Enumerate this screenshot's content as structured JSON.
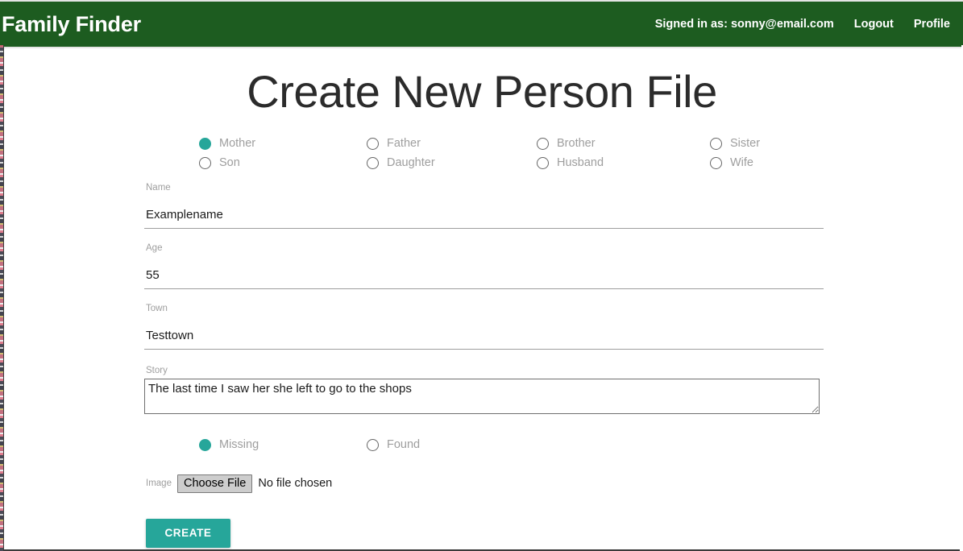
{
  "navbar": {
    "brand": "Family Finder",
    "signed_in_text": "Signed in as: sonny@email.com",
    "logout_label": "Logout",
    "profile_label": "Profile"
  },
  "page": {
    "title": "Create New Person File"
  },
  "colors": {
    "navbar_green": "#1d5c20",
    "accent_teal": "#26a69a",
    "label_gray": "#9e9e9e",
    "text_dark": "#1b1b1b"
  },
  "relation_options": [
    {
      "label": "Mother",
      "checked": true,
      "col": 0,
      "row": 0
    },
    {
      "label": "Father",
      "checked": false,
      "col": 1,
      "row": 0
    },
    {
      "label": "Brother",
      "checked": false,
      "col": 2,
      "row": 0
    },
    {
      "label": "Sister",
      "checked": false,
      "col": 3,
      "row": 0
    },
    {
      "label": "Son",
      "checked": false,
      "col": 0,
      "row": 1
    },
    {
      "label": "Daughter",
      "checked": false,
      "col": 1,
      "row": 1
    },
    {
      "label": "Husband",
      "checked": false,
      "col": 2,
      "row": 1
    },
    {
      "label": "Wife",
      "checked": false,
      "col": 3,
      "row": 1
    }
  ],
  "fields": {
    "name": {
      "label": "Name",
      "value": "Examplename",
      "placeholder": ""
    },
    "age": {
      "label": "Age",
      "value": "55",
      "placeholder": ""
    },
    "town": {
      "label": "Town",
      "value": "Testtown",
      "placeholder": ""
    },
    "story": {
      "label": "Story",
      "value": "The last time I saw her she left to go to the shops",
      "placeholder": ""
    }
  },
  "status_options": [
    {
      "label": "Missing",
      "checked": true
    },
    {
      "label": "Found",
      "checked": false
    }
  ],
  "image_upload": {
    "label": "Image",
    "button_label": "Choose File",
    "status_text": "No file chosen"
  },
  "submit": {
    "label": "CREATE"
  }
}
